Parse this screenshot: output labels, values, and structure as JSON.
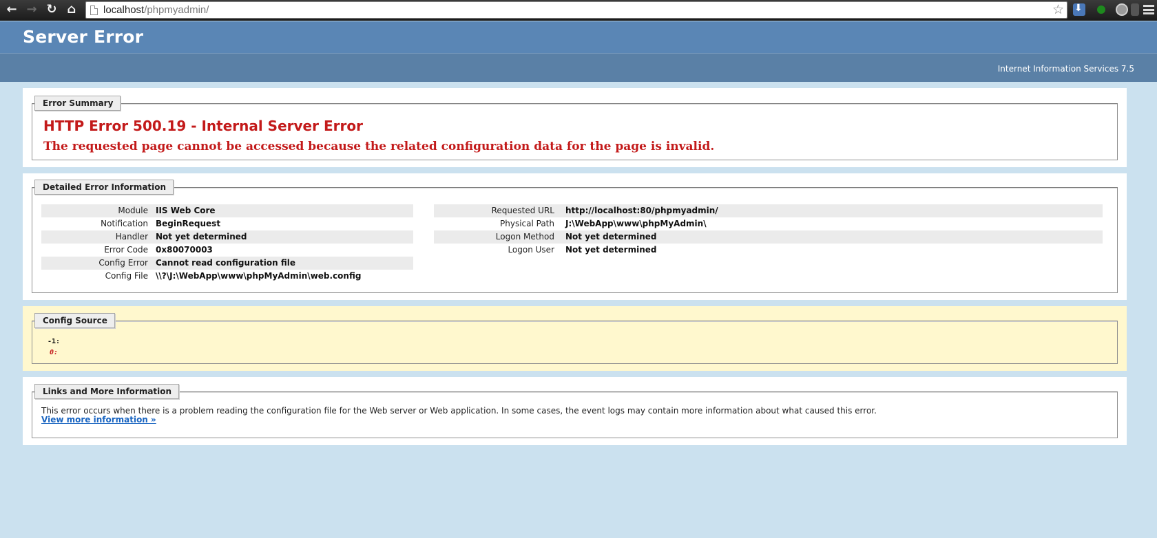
{
  "browser": {
    "back_icon": "←",
    "forward_icon": "→",
    "reload_icon": "↻",
    "home_icon": "⌂",
    "url_host": "localhost",
    "url_path": "/phpmyadmin/",
    "star_icon": "☆"
  },
  "header": {
    "title": "Server Error",
    "server": "Internet Information Services 7.5"
  },
  "summary": {
    "legend": "Error Summary",
    "title": "HTTP Error 500.19 - Internal Server Error",
    "description": "The requested page cannot be accessed because the related configuration data for the page is invalid."
  },
  "details": {
    "legend": "Detailed Error Information",
    "left": [
      {
        "label": "Module",
        "value": "IIS Web Core"
      },
      {
        "label": "Notification",
        "value": "BeginRequest"
      },
      {
        "label": "Handler",
        "value": "Not yet determined"
      },
      {
        "label": "Error Code",
        "value": "0x80070003"
      },
      {
        "label": "Config Error",
        "value": "Cannot read configuration file"
      },
      {
        "label": "Config File",
        "value": "\\\\?\\J:\\WebApp\\www\\phpMyAdmin\\web.config"
      }
    ],
    "right": [
      {
        "label": "Requested URL",
        "value": "http://localhost:80/phpmyadmin/"
      },
      {
        "label": "Physical Path",
        "value": "J:\\WebApp\\www\\phpMyAdmin\\"
      },
      {
        "label": "Logon Method",
        "value": "Not yet determined"
      },
      {
        "label": "Logon User",
        "value": "Not yet determined"
      }
    ]
  },
  "config_source": {
    "legend": "Config Source",
    "lines": [
      "-1:",
      "0:"
    ]
  },
  "links": {
    "legend": "Links and More Information",
    "text": "This error occurs when there is a problem reading the configuration file for the Web server or Web application. In some cases, the event logs may contain more information about what caused this error.",
    "link": "View more information »"
  },
  "colors": {
    "error_red": "#c31a1a",
    "header_blue": "#5a86b5",
    "page_bg": "#cbe1ef",
    "link_blue": "#1a65c1",
    "config_bg": "#fff8ce"
  }
}
